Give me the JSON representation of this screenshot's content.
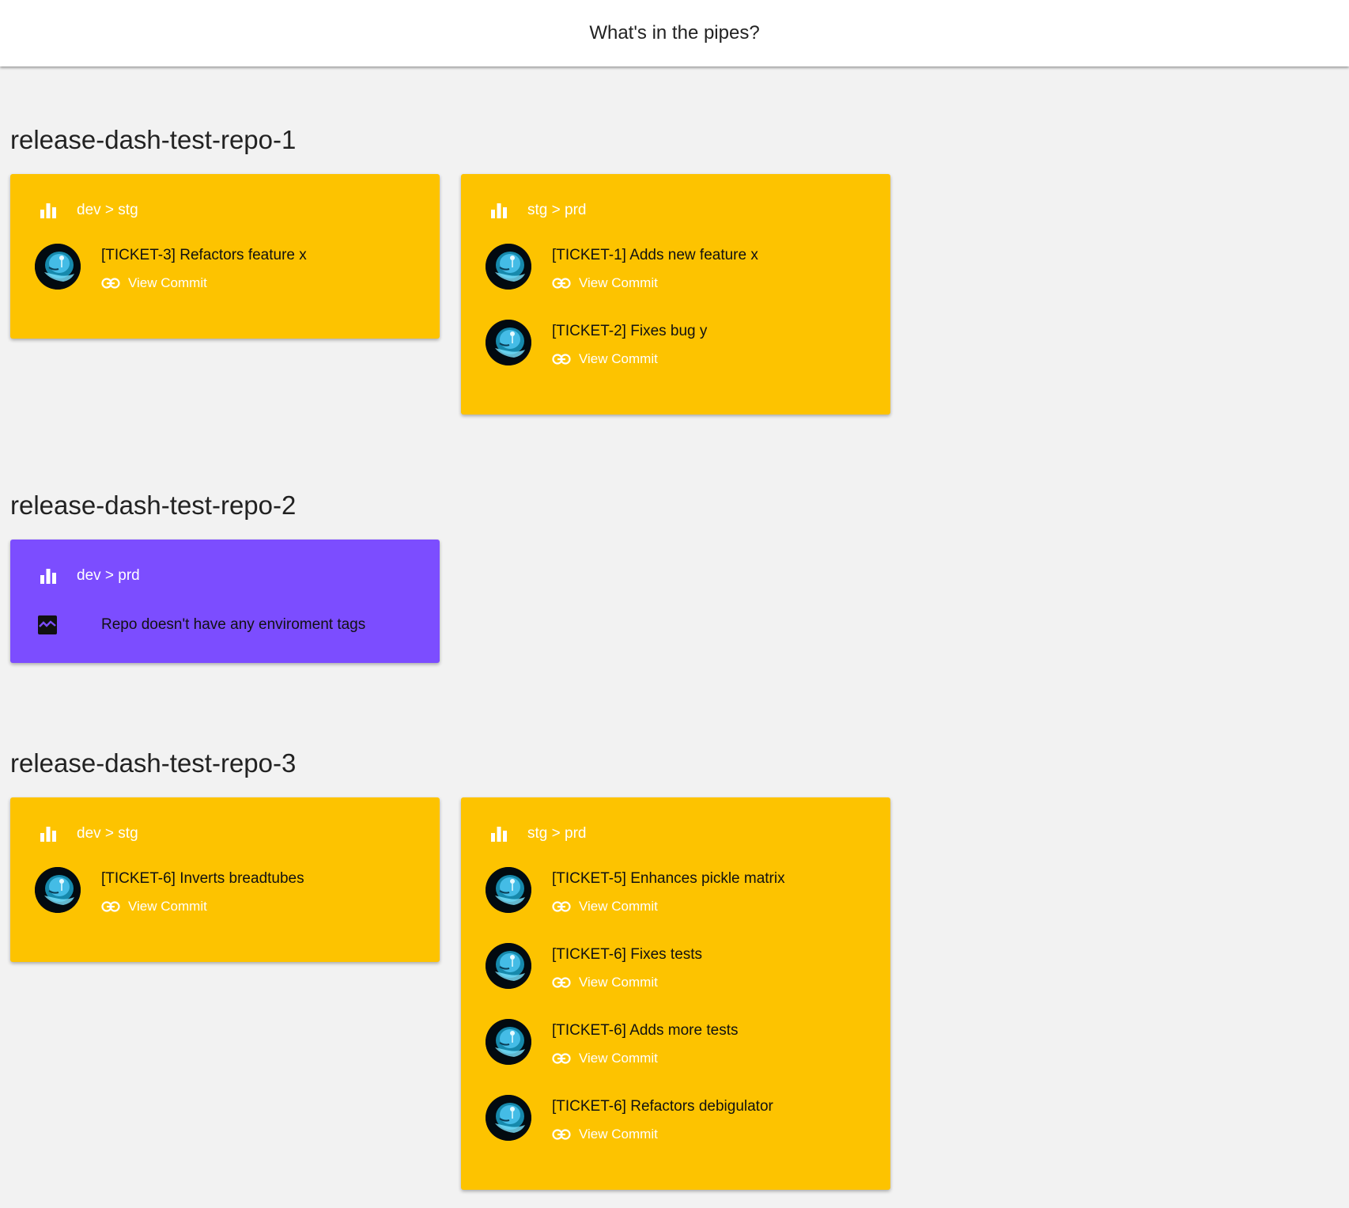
{
  "header": {
    "title": "What's in the pipes?"
  },
  "colors": {
    "yellow": "#fdc300",
    "purple": "#7c4dff",
    "background": "#f2f2f2"
  },
  "repos": [
    {
      "name": "release-dash-test-repo-1",
      "cards": [
        {
          "env": "dev > stg",
          "color": "yellow",
          "icon": "bar-chart-icon",
          "commits": [
            {
              "message": "[TICKET-3] Refactors feature x",
              "link_label": "View Commit"
            }
          ]
        },
        {
          "env": "stg > prd",
          "color": "yellow",
          "icon": "bar-chart-icon",
          "commits": [
            {
              "message": "[TICKET-1] Adds new feature x",
              "link_label": "View Commit"
            },
            {
              "message": "[TICKET-2] Fixes bug y",
              "link_label": "View Commit"
            }
          ]
        }
      ]
    },
    {
      "name": "release-dash-test-repo-2",
      "cards": [
        {
          "env": "dev > prd",
          "color": "purple",
          "icon": "bar-chart-icon",
          "notice": "Repo doesn't have any enviroment tags",
          "notice_icon": "broken-image-icon"
        }
      ]
    },
    {
      "name": "release-dash-test-repo-3",
      "cards": [
        {
          "env": "dev > stg",
          "color": "yellow",
          "icon": "bar-chart-icon",
          "commits": [
            {
              "message": "[TICKET-6] Inverts breadtubes",
              "link_label": "View Commit"
            }
          ]
        },
        {
          "env": "stg > prd",
          "color": "yellow",
          "icon": "bar-chart-icon",
          "commits": [
            {
              "message": "[TICKET-5] Enhances pickle matrix",
              "link_label": "View Commit"
            },
            {
              "message": "[TICKET-6] Fixes tests",
              "link_label": "View Commit"
            },
            {
              "message": "[TICKET-6] Adds more tests",
              "link_label": "View Commit"
            },
            {
              "message": "[TICKET-6] Refactors debigulator",
              "link_label": "View Commit"
            }
          ]
        }
      ]
    }
  ]
}
